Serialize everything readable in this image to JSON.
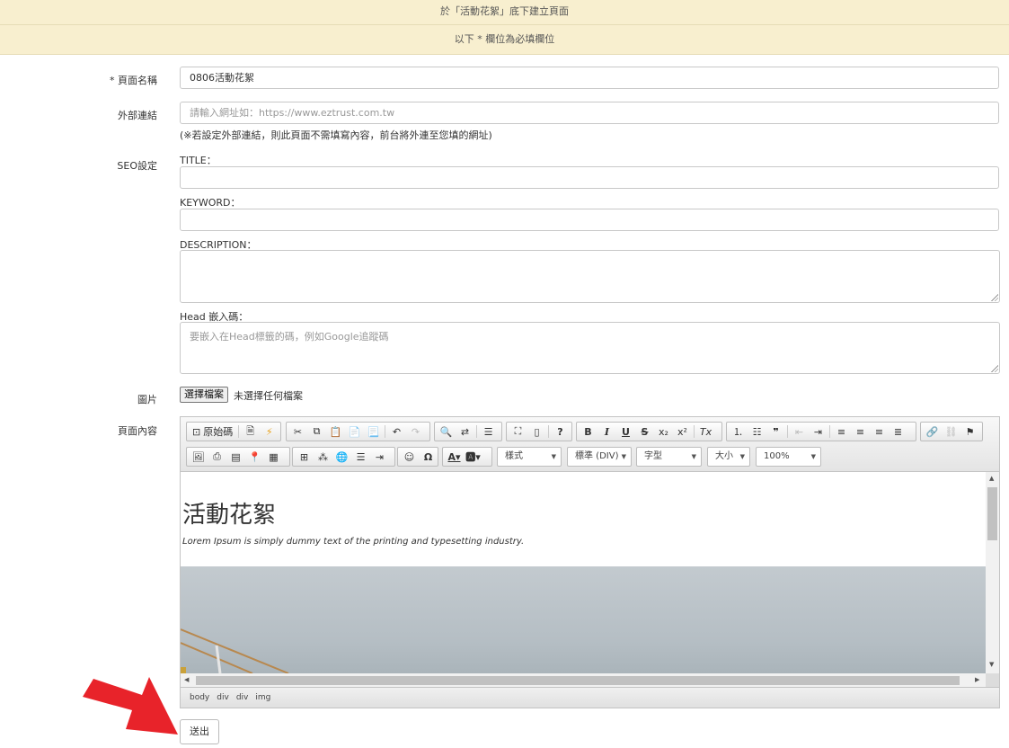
{
  "banner": {
    "create_notice": "於「活動花絮」底下建立頁面",
    "required_notice": "以下 * 欄位為必填欄位"
  },
  "form": {
    "page_name": {
      "label": "* 頁面名稱",
      "value": "0806活動花絮"
    },
    "external_link": {
      "label": "外部連結",
      "placeholder": "請輸入網址如：https://www.eztrust.com.tw",
      "note": "(※若設定外部連結，則此頁面不需填寫內容，前台將外連至您填的網址)"
    },
    "seo": {
      "label": "SEO設定",
      "title_label": "TITLE：",
      "keyword_label": "KEYWORD：",
      "description_label": "DESCRIPTION：",
      "head_label": "Head 嵌入碼：",
      "head_placeholder": "要嵌入在Head標籤的碼，例如Google追蹤碼"
    },
    "image": {
      "label": "圖片",
      "button": "選擇檔案",
      "status": "未選擇任何檔案"
    },
    "content": {
      "label": "頁面內容"
    },
    "submit": "送出"
  },
  "editor": {
    "source_label": "原始碼",
    "combos": {
      "style": "樣式",
      "format": "標準 (DIV)",
      "font": "字型",
      "size": "大小",
      "zoom": "100%"
    },
    "content_heading": "活動花絮",
    "content_paragraph": "Lorem Ipsum is simply dummy text of the printing and typesetting industry.",
    "path": [
      "body",
      "div",
      "div",
      "img"
    ]
  },
  "colors": {
    "banner_bg": "#f8efcf",
    "arrow": "#e8232a"
  }
}
